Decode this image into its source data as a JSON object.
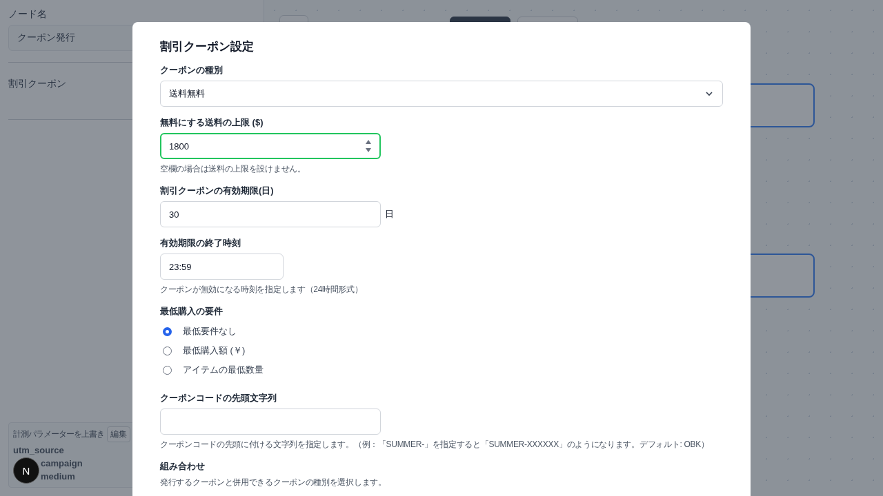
{
  "sidebar": {
    "node_name_label": "ノード名",
    "node_name_value": "クーポン発行",
    "section_label": "割引クーポン",
    "tracking": {
      "title": "計測パラメーターを上書き",
      "edit_button": "編集",
      "params": [
        {
          "text": "utm_source",
          "behind_avatar": false
        },
        {
          "text": "campaign",
          "behind_avatar": true
        },
        {
          "text": "medium",
          "behind_avatar": true
        }
      ]
    }
  },
  "avatar": "N",
  "dialog": {
    "title": "割引クーポン設定",
    "fields": [
      {
        "kind": "select",
        "label": "クーポンの種別",
        "value": "送料無料"
      },
      {
        "kind": "number",
        "label": "無料にする送料の上限 ($)",
        "value": "1800",
        "focused": true,
        "help": "空欄の場合は送料の上限を設けません。"
      },
      {
        "kind": "text",
        "label": "割引クーポンの有効期限(日)",
        "value": "30",
        "focused": false,
        "suffix": "日"
      },
      {
        "kind": "time",
        "label": "有効期限の終了時刻",
        "value": "23:59",
        "focused": false,
        "help": "クーポンが無効になる時刻を指定します（24時間形式）"
      },
      {
        "kind": "radio",
        "label": "最低購入の要件",
        "options": [
          {
            "label": "最低要件なし",
            "selected": true
          },
          {
            "label": "最低購入額 (￥)",
            "selected": false
          },
          {
            "label": "アイテムの最低数量",
            "selected": false
          }
        ]
      },
      {
        "kind": "text",
        "label": "クーポンコードの先頭文字列",
        "focused": false,
        "help": "クーポンコードの先頭に付ける文字列を指定します。（例：「SUMMER-」を指定すると「SUMMER-XXXXXX」のようになります。デフォルト: OBK）"
      },
      {
        "kind": "section",
        "label": "組み合わせ",
        "help": "発行するクーポンと併用できるクーポンの種別を選択します。"
      }
    ]
  }
}
